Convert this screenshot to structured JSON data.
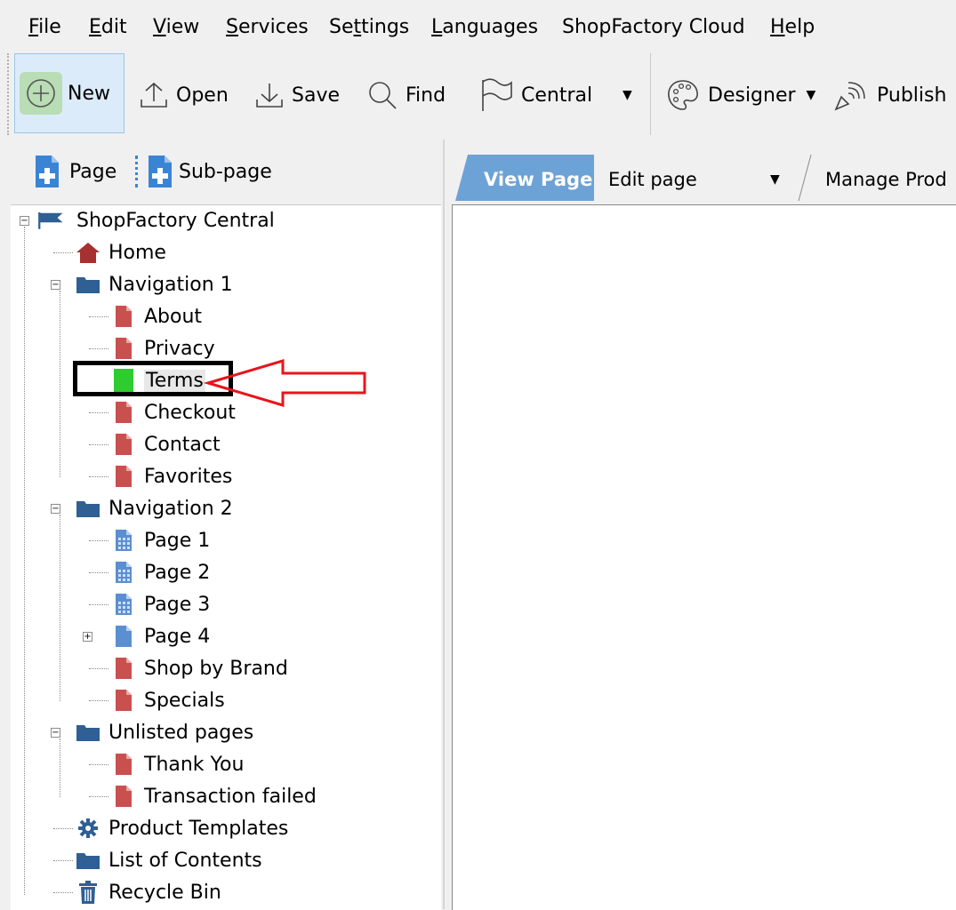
{
  "menu": {
    "items": [
      {
        "label": "File",
        "u": "F",
        "rest": "ile"
      },
      {
        "label": "Edit",
        "u": "E",
        "rest": "dit"
      },
      {
        "label": "View",
        "u": "V",
        "rest": "iew"
      },
      {
        "label": "Services",
        "u": "S",
        "rest": "ervices"
      },
      {
        "label": "Settings",
        "pre": "Se",
        "u": "t",
        "rest": "tings"
      },
      {
        "label": "Languages",
        "u": "L",
        "rest": "anguages"
      },
      {
        "label": "ShopFactory Cloud",
        "pre": "ShopFactory Cloud",
        "u": "",
        "rest": ""
      },
      {
        "label": "Help",
        "u": "H",
        "rest": "elp"
      }
    ]
  },
  "toolbar": {
    "new_label": "New",
    "open_label": "Open",
    "save_label": "Save",
    "find_label": "Find",
    "central_label": "Central",
    "designer_label": "Designer",
    "publish_label": "Publish"
  },
  "left_tools": {
    "page_label": "Page",
    "subpage_label": "Sub-page"
  },
  "tabs": {
    "view_page": "View Page",
    "edit_page": "Edit page",
    "manage_products": "Manage Prod"
  },
  "tree": {
    "root": "ShopFactory Central",
    "home": "Home",
    "nav1": "Navigation 1",
    "nav1_items": [
      "About",
      "Privacy",
      "Terms",
      "Checkout",
      "Contact",
      "Favorites"
    ],
    "nav2": "Navigation 2",
    "nav2_items": [
      "Page 1",
      "Page 2",
      "Page 3",
      "Page 4",
      "Shop by Brand",
      "Specials"
    ],
    "unlisted": "Unlisted pages",
    "unlisted_items": [
      "Thank You",
      "Transaction failed"
    ],
    "product_templates": "Product Templates",
    "list_of_contents": "List of Contents",
    "recycle_bin": "Recycle Bin"
  },
  "colors": {
    "page_red": "#c9504f",
    "page_blue": "#5b8fd0",
    "folder_blue": "#2f5f93",
    "tab_active": "#6da2d6",
    "highlight_green": "#2ecc2e",
    "arrow_red": "#e8141c"
  }
}
